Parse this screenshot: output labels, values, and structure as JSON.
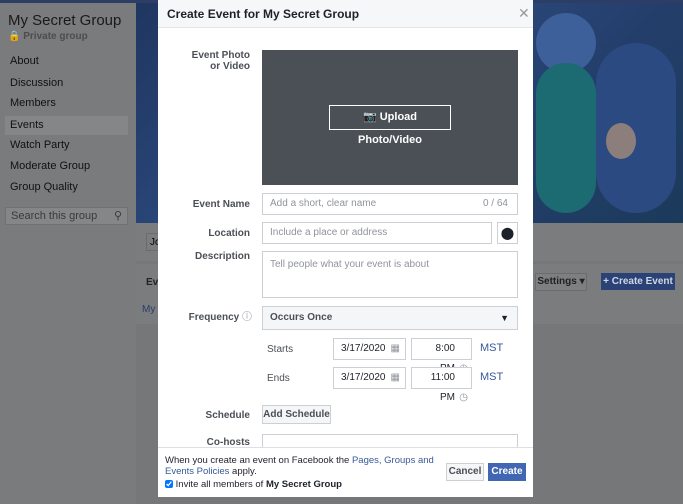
{
  "group": {
    "name": "My Secret Group",
    "privacy": "Private group",
    "nav": [
      "About",
      "Discussion",
      "Members",
      "Events",
      "Watch Party",
      "Moderate Group",
      "Group Quality"
    ],
    "active": "Events",
    "search_placeholder": "Search this group"
  },
  "background": {
    "join_stub": "Jo",
    "events_stub": "Ev",
    "link_stub": "My S",
    "settings": "Settings",
    "create_event": "+ Create Event"
  },
  "modal": {
    "title": "Create Event for My Secret Group",
    "photo_label": "Event Photo or Video",
    "upload": "Upload Photo/Video",
    "name_label": "Event Name",
    "name_placeholder": "Add a short, clear name",
    "name_count": "0 / 64",
    "location_label": "Location",
    "location_placeholder": "Include a place or address",
    "description_label": "Description",
    "description_placeholder": "Tell people what your event is about",
    "frequency_label": "Frequency",
    "frequency_value": "Occurs Once",
    "starts_label": "Starts",
    "start_date": "3/17/2020",
    "start_time": "8:00 PM",
    "start_tz": "MST",
    "ends_label": "Ends",
    "end_date": "3/17/2020",
    "end_time": "11:00 PM",
    "end_tz": "MST",
    "schedule_label": "Schedule",
    "add_schedule": "Add Schedule",
    "cohosts_label": "Co-hosts",
    "footer": {
      "policy_pre": "When you create an event on Facebook the ",
      "policy_link": "Pages, Groups and Events Policies",
      "policy_post": " apply.",
      "invite_pre": "Invite all members of ",
      "invite_group": "My Secret Group",
      "invite_checked": true,
      "cancel": "Cancel",
      "create": "Create"
    }
  },
  "colors": {
    "accent": "#4267b2",
    "link": "#385898",
    "photo_bg": "#4b4f56"
  }
}
